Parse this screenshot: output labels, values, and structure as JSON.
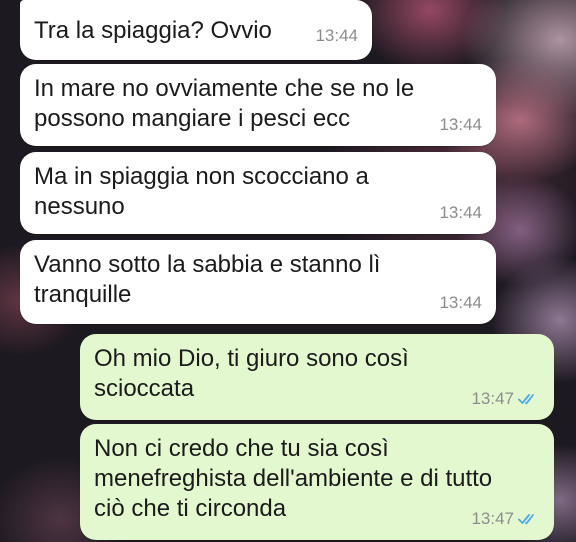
{
  "messages": [
    {
      "direction": "incoming",
      "text": "Tra la spiaggia? Ovvio",
      "time": "13:44"
    },
    {
      "direction": "incoming",
      "text": "In mare no ovviamente che se no le\npossono mangiare i pesci ecc",
      "time": "13:44"
    },
    {
      "direction": "incoming",
      "text": "Ma in spiaggia non scocciano a\nnessuno",
      "time": "13:44"
    },
    {
      "direction": "incoming",
      "text": "Vanno sotto la sabbia e stanno lì\ntranquille",
      "time": "13:44"
    },
    {
      "direction": "outgoing",
      "text": "Oh mio Dio, ti giuro sono così\nscioccata",
      "time": "13:47",
      "status": "read"
    },
    {
      "direction": "outgoing",
      "text": "Non ci credo che tu sia così\nmenefreghista dell'ambiente e di tutto\nciò che ti circonda",
      "time": "13:47",
      "status": "read"
    }
  ],
  "colors": {
    "incoming_bubble": "#ffffff",
    "outgoing_bubble": "#e3f8cf",
    "read_ticks": "#4fa9e8",
    "timestamp": "#8d8d8d"
  },
  "icons": {
    "read_receipt": "double-check-icon"
  }
}
